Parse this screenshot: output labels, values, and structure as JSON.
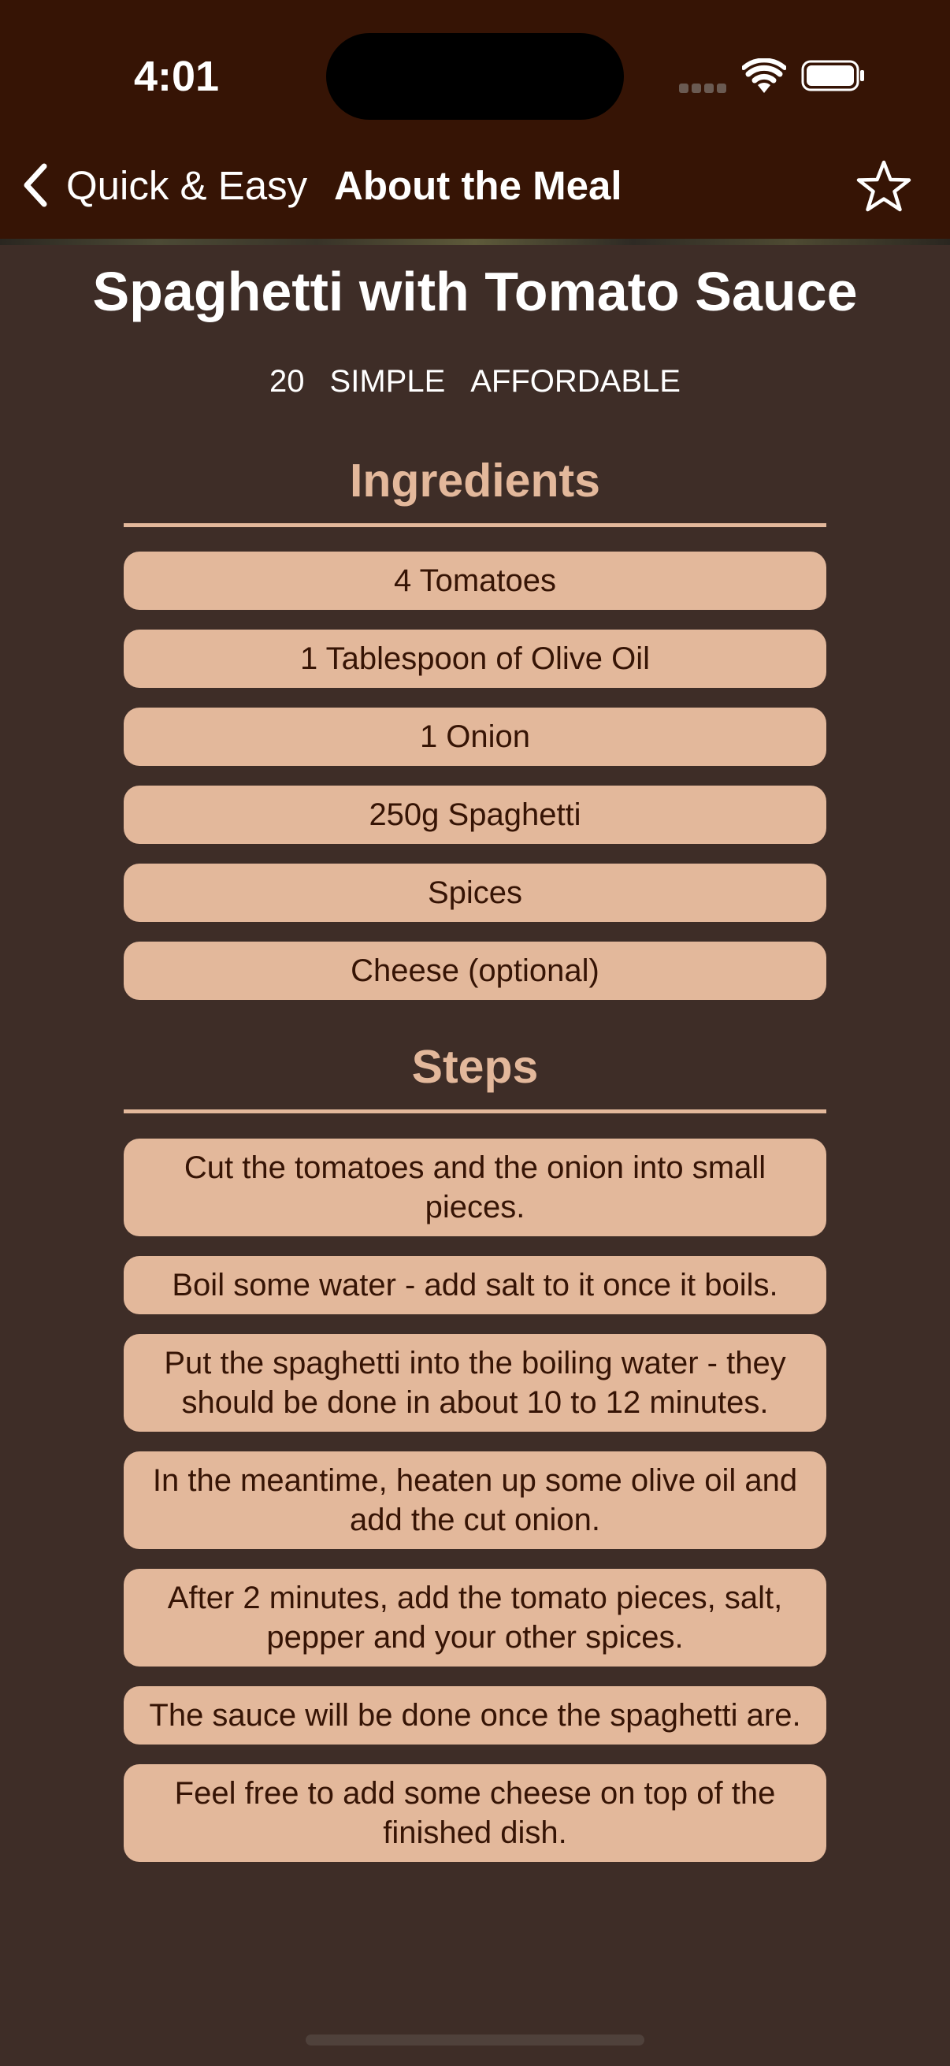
{
  "status": {
    "time": "4:01"
  },
  "nav": {
    "back_label": "Quick & Easy",
    "title": "About the Meal"
  },
  "meal": {
    "title": "Spaghetti with Tomato Sauce",
    "duration": "20",
    "complexity": "SIMPLE",
    "affordability": "AFFORDABLE"
  },
  "ingredients": {
    "heading": "Ingredients",
    "items": [
      "4 Tomatoes",
      "1 Tablespoon of Olive Oil",
      "1 Onion",
      "250g Spaghetti",
      "Spices",
      "Cheese (optional)"
    ]
  },
  "steps": {
    "heading": "Steps",
    "items": [
      "Cut the tomatoes and the onion into small pieces.",
      "Boil some water - add salt to it once it boils.",
      "Put the spaghetti into the boiling water - they should be done in about 10 to 12 minutes.",
      "In the meantime, heaten up some olive oil and add the cut onion.",
      "After 2 minutes, add the tomato pieces, salt, pepper and your other spices.",
      "The sauce will be done once the spaghetti are.",
      "Feel free to add some cheese on top of the finished dish."
    ]
  },
  "icons": {
    "back": "chevron-left-icon",
    "favorite": "star-outline-icon",
    "wifi": "wifi-icon",
    "battery": "battery-icon"
  },
  "colors": {
    "nav_bg": "#361405",
    "page_bg": "#3e2d27",
    "accent": "#e3b89b",
    "pill_text": "#361405"
  }
}
